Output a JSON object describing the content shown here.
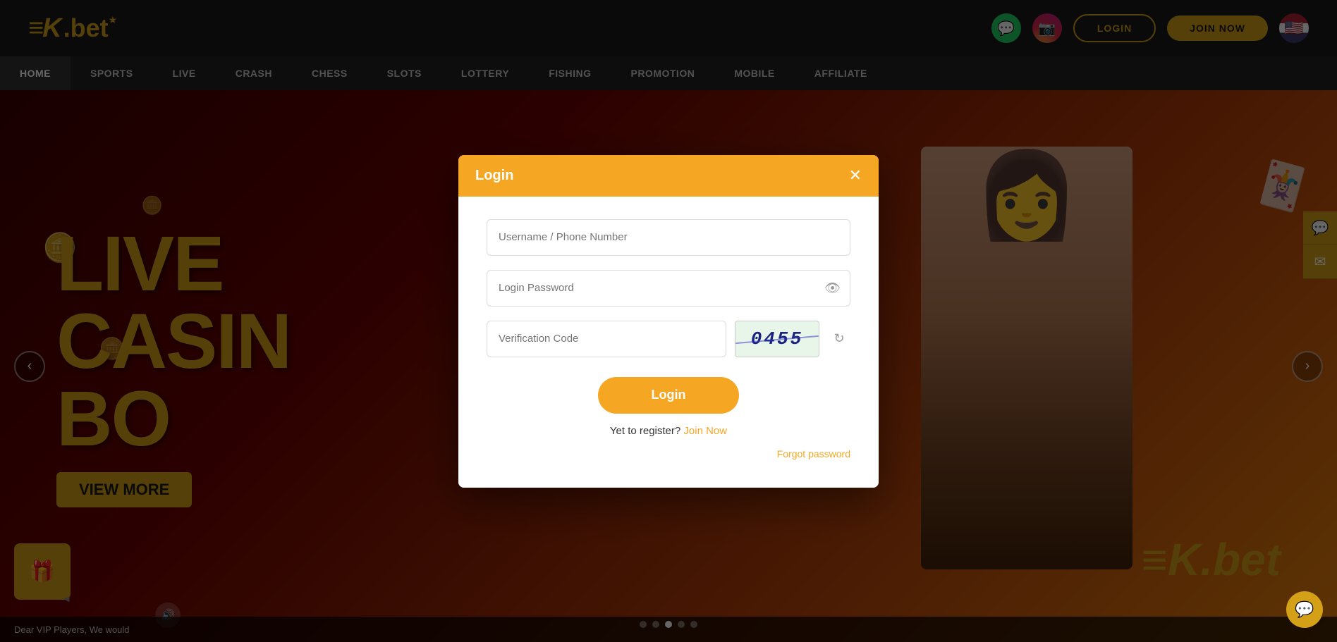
{
  "header": {
    "logo_text": "ek.bet",
    "logo_symbol": "≡K",
    "logo_star": "★",
    "logo_dot": ".bet",
    "btn_login": "LOGIN",
    "btn_join": "JOIN NOW"
  },
  "navbar": {
    "items": [
      {
        "label": "HOME",
        "active": true
      },
      {
        "label": "SPORTS",
        "active": false
      },
      {
        "label": "LIVE",
        "active": false
      },
      {
        "label": "CRASH",
        "active": false
      },
      {
        "label": "CHESS",
        "active": false
      },
      {
        "label": "SLOTS",
        "active": false
      },
      {
        "label": "LOTTERY",
        "active": false
      },
      {
        "label": "FISHING",
        "active": false
      },
      {
        "label": "PROMOTION",
        "active": false
      },
      {
        "label": "MOBILE",
        "active": false
      },
      {
        "label": "AFFILIATE",
        "active": false
      }
    ]
  },
  "hero": {
    "text_line1": "LIVE",
    "text_line2": "CASIN",
    "text_line3": "BO",
    "brand": "≡K.bet",
    "btn_view": "VIEW MORE"
  },
  "ticker": {
    "text": "Dear VIP Players, We would"
  },
  "modal": {
    "title": "Login",
    "username_placeholder": "Username / Phone Number",
    "password_placeholder": "Login Password",
    "captcha_placeholder": "Verification Code",
    "captcha_value": "0455",
    "btn_login": "Login",
    "register_text": "Yet to register?",
    "register_link": "Join Now",
    "forgot_password": "Forgot password"
  }
}
